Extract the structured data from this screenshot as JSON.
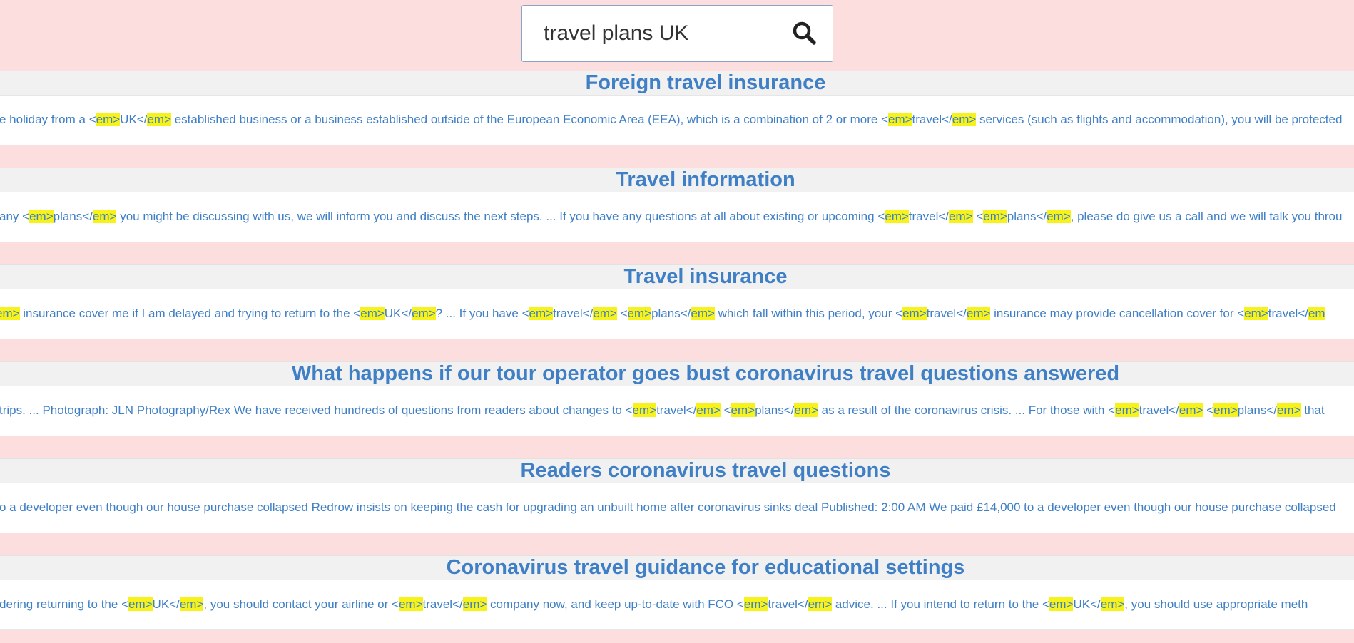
{
  "search": {
    "value": "travel plans UK",
    "placeholder": ""
  },
  "icons": {
    "search": "search-icon"
  },
  "colors": {
    "background": "#fddede",
    "title_band": "#f1f1f1",
    "link": "#3f7fc6",
    "highlight": "#f7f31a"
  },
  "results": [
    {
      "title": "Foreign travel insurance",
      "snippet": "e holiday from a <em>UK</em> established business or a business established outside of the European Economic Area (EEA), which is a combination of 2 or more <em>travel</em> services (such as flights and accommodation), you will be protected"
    },
    {
      "title": "Travel information",
      "snippet": "any <em>plans</em> you might be discussing with us, we will inform you and discuss the next steps. ... If you have any questions at all about existing or upcoming <em>travel</em> <em>plans</em>, please do give us a call and we will talk you throu"
    },
    {
      "title": "Travel insurance",
      "snippet": "em> insurance cover me if I am delayed and trying to return to the <em>UK</em>? ... If you have <em>travel</em> <em>plans</em> which fall within this period, your <em>travel</em> insurance may provide cancellation cover for <em>travel</em"
    },
    {
      "title": "What happens if our tour operator goes bust coronavirus travel questions answered",
      "snippet": "trips. ... Photograph: JLN Photography/Rex We have received hundreds of questions from readers about changes to <em>travel</em> <em>plans</em> as a result of the coronavirus crisis. ... For those with <em>travel</em> <em>plans</em> that"
    },
    {
      "title": "Readers coronavirus travel questions",
      "snippet": "o a developer even though our house purchase collapsed Redrow insists on keeping the cash for upgrading an unbuilt home after coronavirus sinks deal Published: 2:00 AM We paid £14,000 to a developer even though our house purchase collapsed"
    },
    {
      "title": "Coronavirus travel guidance for educational settings",
      "snippet": "dering returning to the <em>UK</em>, you should contact your airline or <em>travel</em> company now, and keep up-to-date with FCO <em>travel</em> advice. ... If you intend to return to the <em>UK</em>, you should use appropriate meth"
    }
  ]
}
